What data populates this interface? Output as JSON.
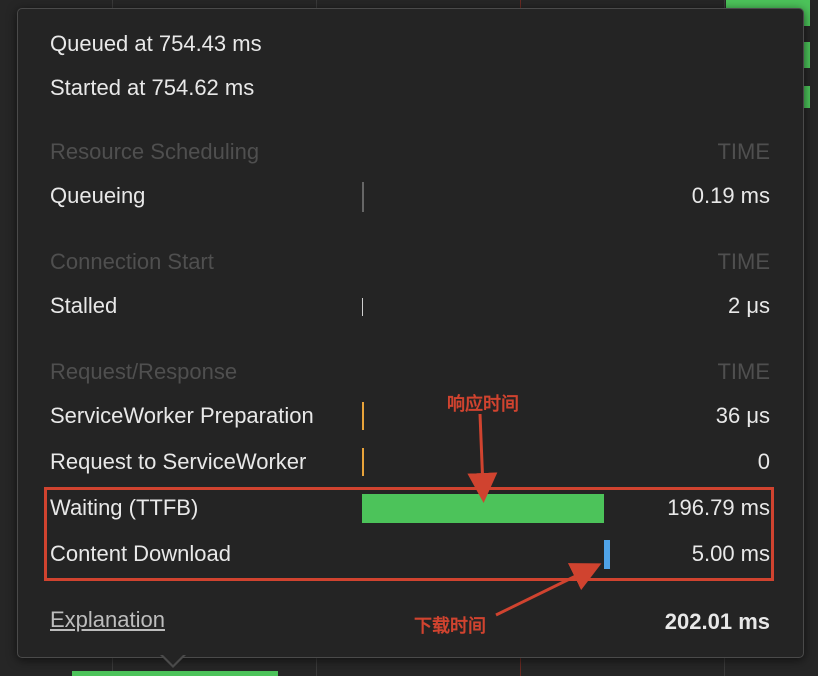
{
  "popover": {
    "queued_at": "Queued at 754.43 ms",
    "started_at": "Started at 754.62 ms",
    "sections": [
      {
        "title": "Resource Scheduling",
        "time_header": "TIME",
        "rows": [
          {
            "label": "Queueing",
            "value": "0.19 ms"
          }
        ]
      },
      {
        "title": "Connection Start",
        "time_header": "TIME",
        "rows": [
          {
            "label": "Stalled",
            "value": "2 μs"
          }
        ]
      },
      {
        "title": "Request/Response",
        "time_header": "TIME",
        "rows": [
          {
            "label": "ServiceWorker Preparation",
            "value": "36 μs"
          },
          {
            "label": "Request to ServiceWorker",
            "value": "0"
          },
          {
            "label": "Waiting (TTFB)",
            "value": "196.79 ms"
          },
          {
            "label": "Content Download",
            "value": "5.00 ms"
          }
        ]
      }
    ],
    "explanation_link": "Explanation",
    "total": "202.01 ms"
  },
  "annotations": {
    "response_time": "响应时间",
    "download_time": "下载时间"
  },
  "colors": {
    "waiting_bar": "#4cc35a",
    "download_bar": "#4fa3e8",
    "sw_tick": "#e8a33a",
    "annotation": "#d0432f"
  }
}
